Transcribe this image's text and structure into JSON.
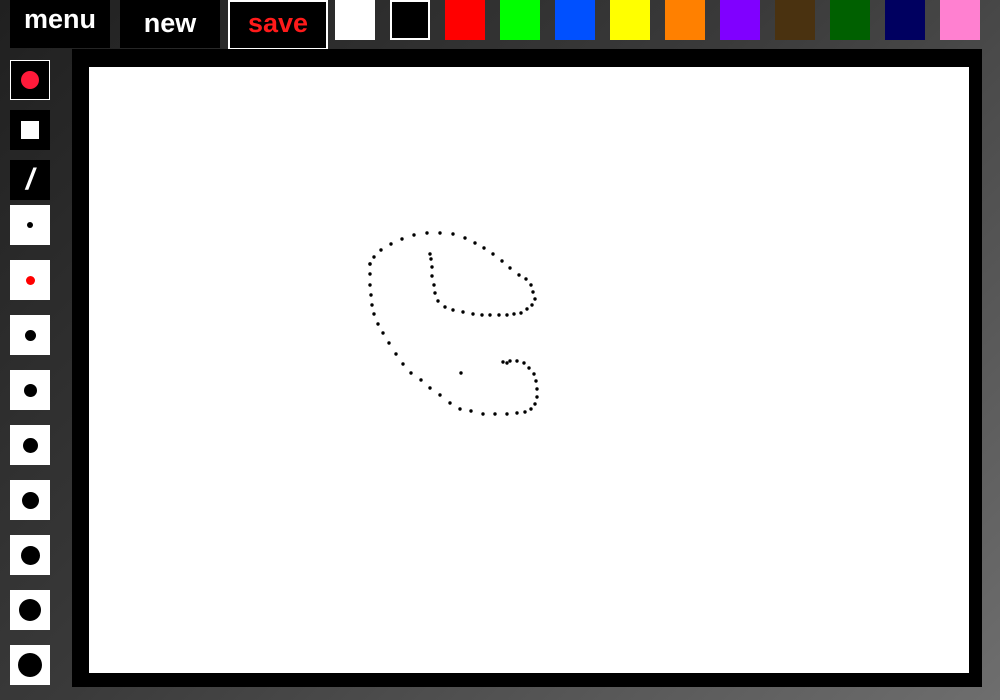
{
  "toolbar": {
    "menu_label": "menu",
    "new_label": "new",
    "save_label": "save"
  },
  "palette": [
    {
      "name": "white",
      "color": "#ffffff"
    },
    {
      "name": "black",
      "color": "#000000",
      "selected": true
    },
    {
      "name": "red",
      "color": "#ff0000"
    },
    {
      "name": "green",
      "color": "#00ff00"
    },
    {
      "name": "blue",
      "color": "#0050ff"
    },
    {
      "name": "yellow",
      "color": "#ffff00"
    },
    {
      "name": "orange",
      "color": "#ff8000"
    },
    {
      "name": "purple",
      "color": "#8000ff"
    },
    {
      "name": "brown",
      "color": "#4a3210"
    },
    {
      "name": "dark-green",
      "color": "#006000"
    },
    {
      "name": "navy",
      "color": "#000060"
    },
    {
      "name": "pink",
      "color": "#ff80d0"
    }
  ],
  "tools": [
    {
      "name": "tool-round-brush",
      "icon": "red-dot-icon",
      "bg": "dark",
      "active": true
    },
    {
      "name": "tool-square-brush",
      "icon": "square-icon",
      "bg": "dark"
    },
    {
      "name": "tool-line",
      "icon": "slash-icon",
      "bg": "dark"
    },
    {
      "name": "size-1",
      "icon": "brush-size-icon",
      "bg": "light",
      "color": "#000000"
    },
    {
      "name": "size-2",
      "icon": "brush-size-icon",
      "bg": "light",
      "color": "#ff0000",
      "active": true
    },
    {
      "name": "size-3",
      "icon": "brush-size-icon",
      "bg": "light",
      "color": "#000000"
    },
    {
      "name": "size-4",
      "icon": "brush-size-icon",
      "bg": "light",
      "color": "#000000"
    },
    {
      "name": "size-5",
      "icon": "brush-size-icon",
      "bg": "light",
      "color": "#000000"
    },
    {
      "name": "size-6",
      "icon": "brush-size-icon",
      "bg": "light",
      "color": "#000000"
    },
    {
      "name": "size-7",
      "icon": "brush-size-icon",
      "bg": "light",
      "color": "#000000"
    },
    {
      "name": "size-8",
      "icon": "brush-size-icon",
      "bg": "light",
      "color": "#000000"
    },
    {
      "name": "size-9",
      "icon": "brush-size-icon",
      "bg": "light",
      "color": "#000000"
    }
  ],
  "colors": {
    "save_text": "#ff1a1a",
    "active_brush": "#ff1a3a",
    "ink": "#000000"
  }
}
